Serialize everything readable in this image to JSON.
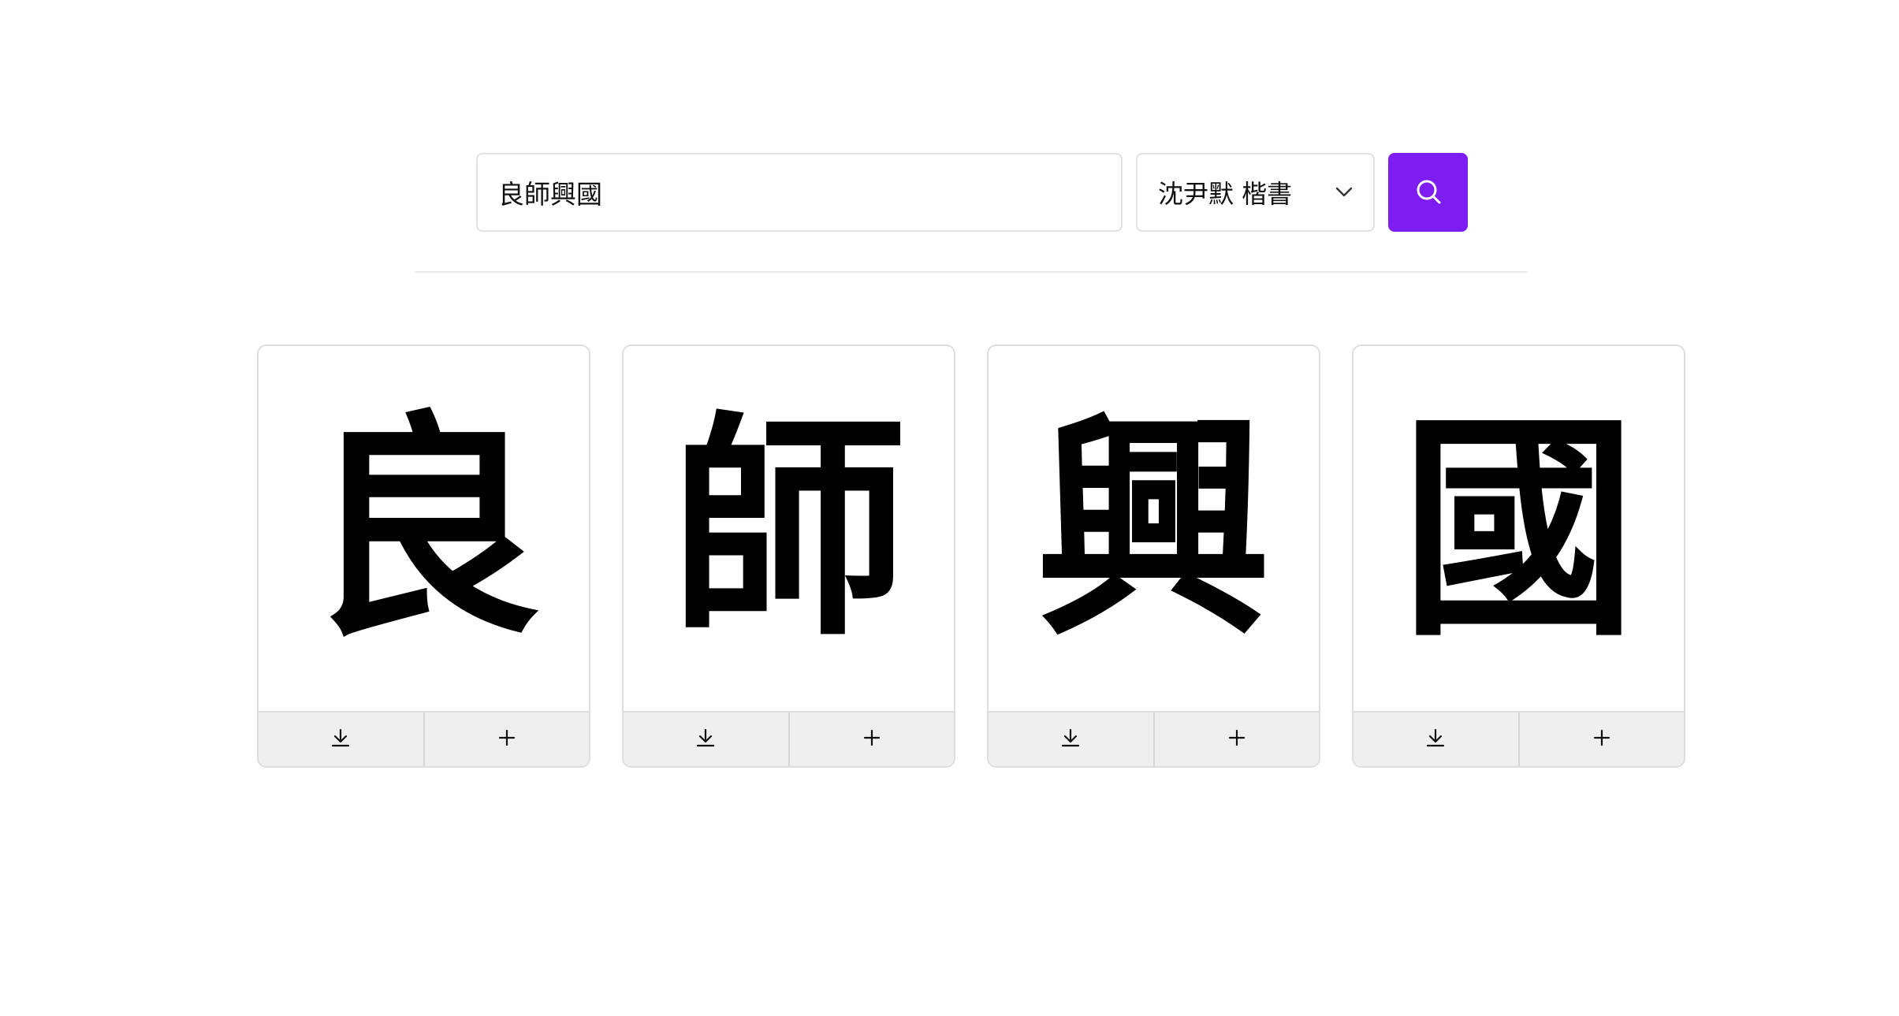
{
  "search": {
    "value": "良師興國"
  },
  "style_select": {
    "selected": "沈尹默 楷書"
  },
  "colors": {
    "accent": "#7e1df2"
  },
  "icons": {
    "search": "search-icon",
    "dropdown": "chevron-down-icon",
    "download": "download-icon",
    "add": "plus-icon"
  },
  "results": [
    {
      "character": "良"
    },
    {
      "character": "師"
    },
    {
      "character": "興"
    },
    {
      "character": "國"
    }
  ]
}
